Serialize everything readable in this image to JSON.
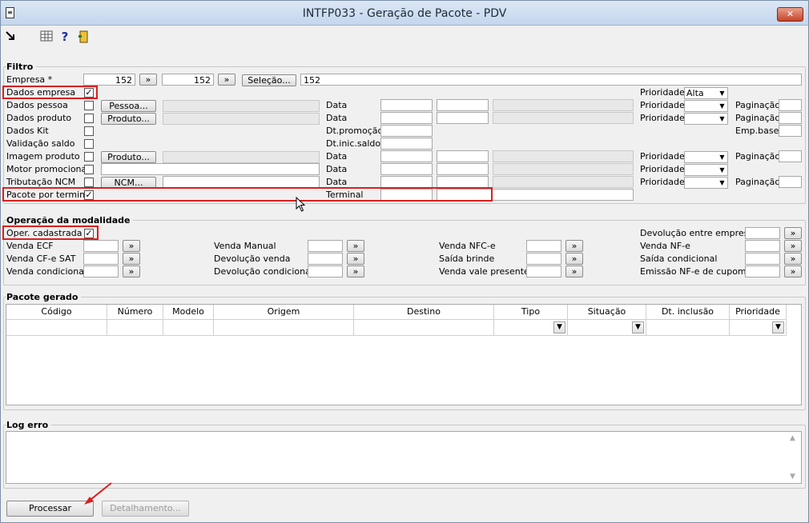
{
  "window": {
    "title": "INTFP033 - Geração de Pacote - PDV"
  },
  "filtro": {
    "title": "Filtro",
    "empresa_label": "Empresa *",
    "empresa_from": "152",
    "empresa_to": "152",
    "selecao_button": "Seleção...",
    "empresa_list": "152",
    "rows": [
      {
        "label": "Dados empresa",
        "checked": "✓"
      },
      {
        "label": "Dados pessoa",
        "checked": ""
      },
      {
        "label": "Dados produto",
        "checked": ""
      },
      {
        "label": "Dados Kit",
        "checked": ""
      },
      {
        "label": "Validação saldo",
        "checked": ""
      },
      {
        "label": "Imagem produto",
        "checked": ""
      },
      {
        "label": "Motor promocional",
        "checked": ""
      },
      {
        "label": "Tributação NCM",
        "checked": ""
      },
      {
        "label": "Pacote por terminal",
        "checked": "✓"
      }
    ],
    "pessoa_button": "Pessoa...",
    "produto_button": "Produto...",
    "produto2_button": "Produto...",
    "ncm_button": "NCM...",
    "data_label": "Data",
    "dt_promocao_label": "Dt.promoção",
    "dt_inic_saldo_label": "Dt.inic.saldo",
    "terminal_label": "Terminal",
    "prioridade_label": "Prioridade",
    "prioridade_empresa_value": "Alta",
    "paginacao_label": "Paginação",
    "emp_base_label": "Emp.base"
  },
  "operacao": {
    "title": "Operação da modalidade",
    "oper_cadastrada_label": "Oper. cadastrada",
    "oper_cadastrada_checked": "✓",
    "col1": [
      "Venda ECF",
      "Venda CF-e SAT",
      "Venda condicional"
    ],
    "col2": [
      "Venda Manual",
      "Devolução venda",
      "Devolução condicional"
    ],
    "col3": [
      "Venda NFC-e",
      "Saída brinde",
      "Venda vale presente"
    ],
    "col4": [
      "Devolução entre empresa",
      "Venda NF-e",
      "Saída condicional",
      "Emissão NF-e de cupom"
    ],
    "arrow": "»"
  },
  "pacote": {
    "title": "Pacote gerado",
    "columns": [
      "Código",
      "Número",
      "Modelo",
      "Origem",
      "Destino",
      "Tipo",
      "Situação",
      "Dt. inclusão",
      "Prioridade"
    ]
  },
  "log": {
    "title": "Log erro"
  },
  "footer": {
    "processar": "Processar",
    "detalhamento": "Detalhamento..."
  }
}
